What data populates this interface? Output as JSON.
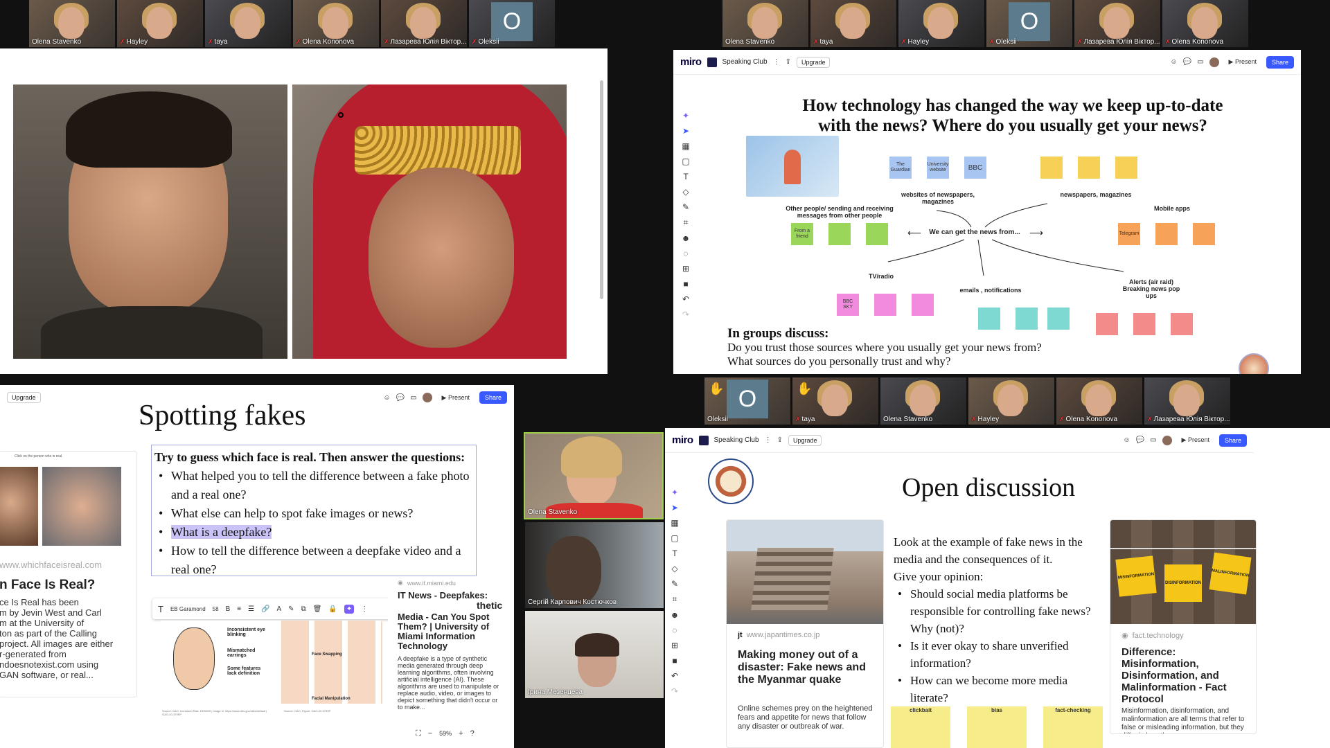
{
  "strip_top_left": [
    {
      "name": "Olena Stavenko",
      "muted": false
    },
    {
      "name": "Hayley",
      "muted": true
    },
    {
      "name": "taya",
      "muted": true
    },
    {
      "name": "Olena Kononova",
      "muted": true
    },
    {
      "name": "Лазарева Юлія Віктор...",
      "muted": true
    },
    {
      "name": "Oleksii",
      "muted": true,
      "initial": "O"
    }
  ],
  "strip_top_right": [
    {
      "name": "Olena Stavenko",
      "muted": false
    },
    {
      "name": "taya",
      "muted": true
    },
    {
      "name": "Hayley",
      "muted": true
    },
    {
      "name": "Oleksii",
      "muted": true,
      "initial": "O"
    },
    {
      "name": "Лазарева Юлія Віктор...",
      "muted": true
    },
    {
      "name": "Olena Kononova",
      "muted": true
    }
  ],
  "strip_mid_right": [
    {
      "name": "Oleksii",
      "muted": false,
      "initial": "O",
      "hand": true
    },
    {
      "name": "taya",
      "muted": true,
      "hand": true
    },
    {
      "name": "Olena Stavenko",
      "muted": false
    },
    {
      "name": "Hayley",
      "muted": true
    },
    {
      "name": "Olena Kononova",
      "muted": true
    },
    {
      "name": "Лазарева Юлія Віктор...",
      "muted": true
    }
  ],
  "miro": {
    "logo": "miro",
    "board": "Speaking Club",
    "upgrade": "Upgrade",
    "present": "▶ Present",
    "share": "Share"
  },
  "q2": {
    "title_line1": "How technology has changed the way we keep up-to-date",
    "title_line2": "with the news? Where do you usually get your news?",
    "center": "We can get the news from...",
    "labels": {
      "websites": "websites of newspapers, magazines",
      "newspapers": "newspapers, magazines",
      "other_people": "Other people/ sending and receiving messages from other people",
      "mobile": "Mobile apps",
      "tv": "TV/radio",
      "emails": "emails , notifications",
      "alerts": "Alerts (air raid) Breaking news pop ups"
    },
    "stickies": {
      "guardian": "The Guardian",
      "university": "University website",
      "bbc": "BBC",
      "friend": "From a friend",
      "telegram": "Telegram",
      "bbc_sky": "BBC SKY"
    },
    "discuss_title": "In groups discuss:",
    "discuss_1": "Do you trust those sources where you usually get your news from?",
    "discuss_2": "What sources do you personally trust and why?"
  },
  "q3": {
    "upgrade": "Upgrade",
    "present": "▶ Present",
    "share": "Share",
    "title": "Spotting fakes",
    "intro": "Try to guess which face is real. Then answer the questions:",
    "items": [
      "What helped you to tell the difference between a fake photo and a real one?",
      "What else can help to spot fake images or news?",
      "What is a deepfake?",
      "How to tell the difference between a deepfake video and a real one?"
    ],
    "card_caption": "Click on the person who is real.",
    "card_url": "www.whichfaceisreal.com",
    "card_title": "n Face Is Real?",
    "card_desc": "ce Is Real has been\nm by Jevin West and Carl\nm at the University of\nton as part of the Calling\nproject. All images are either\nr-generated from\nndoesnotexist.com using\nGAN software, or real...",
    "toolbar_font": "EB Garamond",
    "toolbar_size": "58",
    "diagram_1": "Inconsistent eye blinking",
    "diagram_2": "Mismatched earrings",
    "diagram_3": "Some features lack definition",
    "diagram_4": "Face Swapping",
    "diagram_5": "Facial Manipulation",
    "diagram_src_1": "Source: GAO; Increased Risk: DHS/MS | Image in: https://www.dhs.gov/sites/default | GAO-20-379SP",
    "diagram_src_2": "Source: GAO; Figure: GAO-20-379SP",
    "it_url": "www.it.miami.edu",
    "it_title_partial": "IT News - Deepfakes:",
    "it_overlap": "thetic",
    "it_title": "Media - Can You Spot Them? | University of Miami Information Technology",
    "it_desc": "A deepfake is a type of synthetic media generated through deep learning algorithms, often involving artificial intelligence (AI). These algorithms are used to manipulate or replace audio, video, or images to depict something that didn't occur or to make...",
    "zoom": "59%"
  },
  "cams": [
    {
      "name": "Olena Stavenko"
    },
    {
      "name": "Сергій Карпович Костючков"
    },
    {
      "name": "Ірина Мезенцева"
    }
  ],
  "q4": {
    "title": "Open discussion",
    "intro": "Look at the example of fake news in the media and the consequences of it.",
    "prompt": "Give your opinion:",
    "items": [
      "Should social media platforms be responsible for controlling fake news? Why (not)?",
      "Is it ever okay to share unverified information?",
      "How can we become more media literate?"
    ],
    "card1_src": "www.japantimes.co.jp",
    "card1_logo": "jt",
    "card1_title": "Making money out of a disaster: Fake news and the Myanmar quake",
    "card1_desc": "Online schemes prey on the heightened fears and appetite for news that follow any disaster or outbreak of war.",
    "card2_src": "fact.technology",
    "card2_title": "Difference: Misinformation, Disinformation, and Malinformation - Fact Protocol",
    "card2_desc": "Misinformation, disinformation, and malinformation are all terms that refer to false or misleading information, but they differ in how they",
    "tags": [
      "MISINFORMATION",
      "DISINFORMATION",
      "MALINFORMATION"
    ],
    "sticky1": "clickbait",
    "sticky2": "bias",
    "sticky3": "fact-checking"
  },
  "colors": {
    "yellow": "#f7d155",
    "green": "#9ad65a",
    "blue": "#a8c4f0",
    "orange": "#f7a259",
    "pink": "#f28bde",
    "teal": "#7fd9d3",
    "red": "#f38b8b",
    "share": "#3859ff"
  }
}
